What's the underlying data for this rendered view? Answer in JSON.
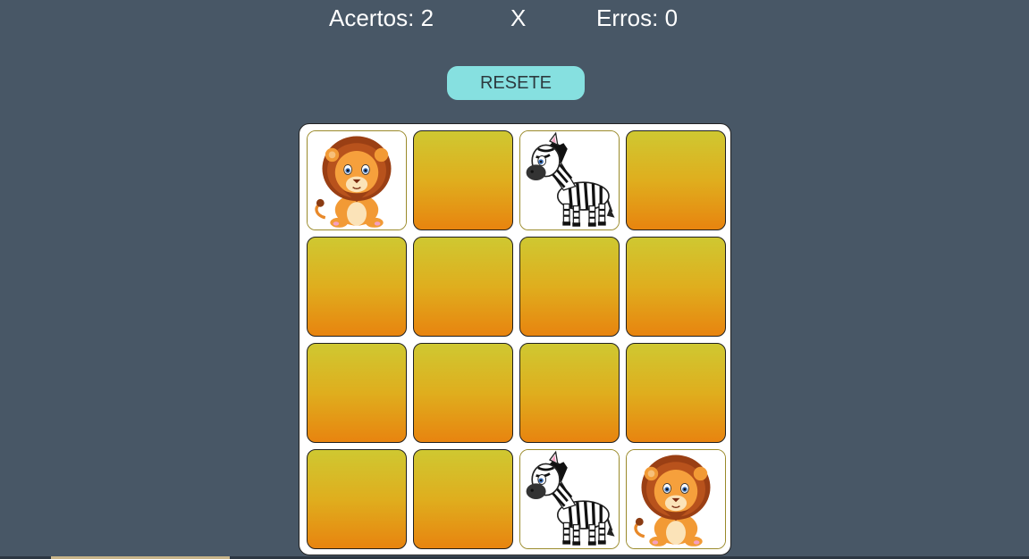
{
  "scoreboard": {
    "hits_text": "Acertos: 2",
    "separator": "X",
    "errors_text": "Erros: 0"
  },
  "controls": {
    "reset_label": "RESETE"
  },
  "board": {
    "rows": 4,
    "cols": 4,
    "cards": [
      {
        "state": "face",
        "animal": "lion"
      },
      {
        "state": "back",
        "animal": ""
      },
      {
        "state": "face",
        "animal": "zebra"
      },
      {
        "state": "back",
        "animal": ""
      },
      {
        "state": "back",
        "animal": ""
      },
      {
        "state": "back",
        "animal": ""
      },
      {
        "state": "back",
        "animal": ""
      },
      {
        "state": "back",
        "animal": ""
      },
      {
        "state": "back",
        "animal": ""
      },
      {
        "state": "back",
        "animal": ""
      },
      {
        "state": "back",
        "animal": ""
      },
      {
        "state": "back",
        "animal": ""
      },
      {
        "state": "back",
        "animal": ""
      },
      {
        "state": "back",
        "animal": ""
      },
      {
        "state": "face",
        "animal": "zebra"
      },
      {
        "state": "face",
        "animal": "lion"
      }
    ]
  },
  "colors": {
    "background": "#485766",
    "button": "#86e0e0",
    "card_back_top": "#cfc831",
    "card_back_bottom": "#e8840f"
  }
}
